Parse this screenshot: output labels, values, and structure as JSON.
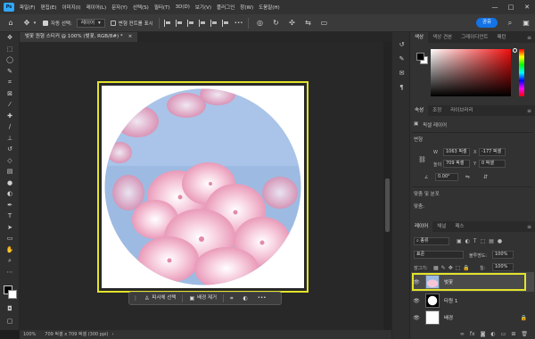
{
  "menubar": {
    "logo": "Ps",
    "items": [
      "파일(F)",
      "편집(E)",
      "이미지(I)",
      "레이어(L)",
      "문자(Y)",
      "선택(S)",
      "필터(T)",
      "3D(D)",
      "보기(V)",
      "플러그인",
      "창(W)",
      "도움말(H)"
    ],
    "window_controls": [
      "—",
      "□",
      "✕"
    ]
  },
  "options": {
    "home_icon": "home-icon",
    "move_icon": "move-icon",
    "auto_select_label": "자동 선택:",
    "auto_select_value": "레이어",
    "show_transform_label": "변형 컨트롤 표시",
    "more": "•••",
    "share_label": "공유"
  },
  "document": {
    "tab_title": "벚꽃 원형 스티커 @ 100% (벚꽃, RGB/8#) *",
    "tab_close": "×"
  },
  "taskbar": {
    "select_subject": "피사체 선택",
    "remove_bg": "배경 제거",
    "more": "•••"
  },
  "status": {
    "zoom": "100%",
    "doc_info": "709 픽셀 x 709 픽셀 (300 ppi)",
    "arrow": "›"
  },
  "color_panel": {
    "tabs": [
      "색상",
      "색상 견본",
      "그레이디언트",
      "패턴"
    ],
    "fg_color": "#000000",
    "bg_color": "#ffffff",
    "picker_hue": "#f20d0d"
  },
  "properties": {
    "tabs": [
      "속성",
      "조정",
      "라이브러리"
    ],
    "layer_type": "픽셀 레이어",
    "transform_title": "변형",
    "w_label": "W",
    "w_value": "1063 픽셀",
    "x_label": "X",
    "x_value": "-177 픽셀",
    "h_label": "높이",
    "h_value": "709 픽셀",
    "y_label": "Y",
    "y_value": "0 픽셀",
    "angle_value": "0.00°",
    "align_title": "맞춤 및 분포",
    "align_sub": "맞춤:"
  },
  "layers": {
    "tabs": [
      "레이어",
      "채널",
      "패스"
    ],
    "filter_label": "종류",
    "blend_mode": "표준",
    "opacity_label": "불투명도:",
    "opacity_value": "100%",
    "lock_label": "잠그기:",
    "fill_label": "칠:",
    "fill_value": "100%",
    "items": [
      {
        "name": "벚꽃"
      },
      {
        "name": "타원 1"
      },
      {
        "name": "배경"
      }
    ],
    "footer_icons": [
      "link-icon",
      "fx-icon",
      "mask-icon",
      "adjustment-icon",
      "folder-icon",
      "new-layer-icon",
      "trash-icon"
    ]
  }
}
